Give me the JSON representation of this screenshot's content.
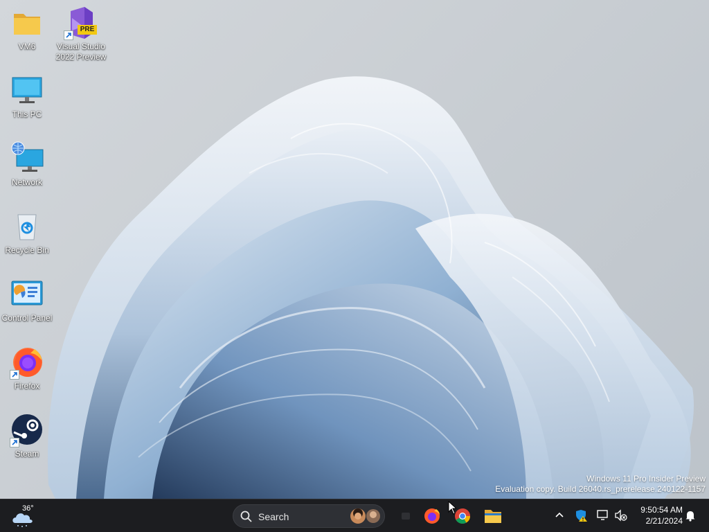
{
  "desktop": {
    "icons": [
      {
        "label": "VM6",
        "icon": "folder-icon"
      },
      {
        "label": "Visual Studio\n2022 Preview",
        "icon": "visual-studio-icon",
        "badge": "PRE"
      },
      {
        "label": "This PC",
        "icon": "monitor-icon"
      },
      {
        "label": "Network",
        "icon": "network-icon"
      },
      {
        "label": "Recycle Bin",
        "icon": "recycle-bin-icon"
      },
      {
        "label": "Control Panel",
        "icon": "control-panel-icon"
      },
      {
        "label": "Firefox",
        "icon": "firefox-icon"
      },
      {
        "label": "Steam",
        "icon": "steam-icon"
      }
    ],
    "watermark": {
      "line1": "Windows 11 Pro Insider Preview",
      "line2": "Evaluation copy. Build 26040.rs_prerelease.240122-1157"
    }
  },
  "taskbar": {
    "weather_temp": "36°",
    "search_label": "Search",
    "apps": [
      "firefox-icon",
      "chrome-icon",
      "file-explorer-icon"
    ],
    "clock": {
      "time": "9:50:54 AM",
      "date": "2/21/2024"
    }
  },
  "colors": {
    "taskbar_bg": "#1c1d20",
    "wallpaper_blue": "#5f86b3"
  }
}
